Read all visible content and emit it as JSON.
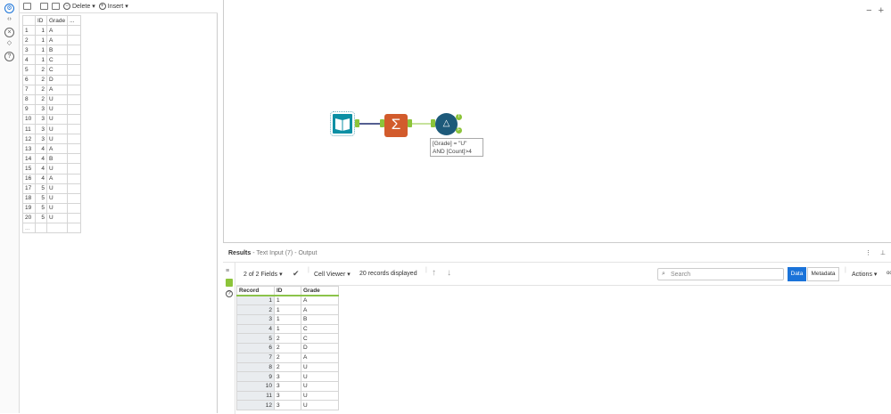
{
  "config": {
    "toolbar": {
      "delete_label": "Delete",
      "insert_label": "Insert"
    },
    "grid": {
      "headers": [
        "",
        "ID",
        "Grade",
        "..."
      ],
      "rows": [
        [
          "1",
          "1",
          "A"
        ],
        [
          "2",
          "1",
          "A"
        ],
        [
          "3",
          "1",
          "B"
        ],
        [
          "4",
          "1",
          "C"
        ],
        [
          "5",
          "2",
          "C"
        ],
        [
          "6",
          "2",
          "D"
        ],
        [
          "7",
          "2",
          "A"
        ],
        [
          "8",
          "2",
          "U"
        ],
        [
          "9",
          "3",
          "U"
        ],
        [
          "10",
          "3",
          "U"
        ],
        [
          "11",
          "3",
          "U"
        ],
        [
          "12",
          "3",
          "U"
        ],
        [
          "13",
          "4",
          "A"
        ],
        [
          "14",
          "4",
          "B"
        ],
        [
          "15",
          "4",
          "U"
        ],
        [
          "16",
          "4",
          "A"
        ],
        [
          "17",
          "5",
          "U"
        ],
        [
          "18",
          "5",
          "U"
        ],
        [
          "19",
          "5",
          "U"
        ],
        [
          "20",
          "5",
          "U"
        ]
      ],
      "new_row": "..."
    }
  },
  "canvas": {
    "zoom_out": "−",
    "zoom_in": "+",
    "filter_annotation_line1": "[Grade] = \"U\"",
    "filter_annotation_line2": "AND [Count]>4",
    "anchor_true": "T",
    "anchor_false": "F"
  },
  "results": {
    "title": "Results",
    "subtitle": " - Text Input (7) - Output",
    "fields_label": "2 of 2 Fields",
    "cell_viewer_label": "Cell Viewer",
    "records_label": "20 records displayed",
    "search_placeholder": "Search",
    "data_label": "Data",
    "metadata_label": "Metadata",
    "actions_label": "Actions",
    "headers": [
      "Record",
      "ID",
      "Grade"
    ],
    "rows": [
      [
        "1",
        "1",
        "A"
      ],
      [
        "2",
        "1",
        "A"
      ],
      [
        "3",
        "1",
        "B"
      ],
      [
        "4",
        "1",
        "C"
      ],
      [
        "5",
        "2",
        "C"
      ],
      [
        "6",
        "2",
        "D"
      ],
      [
        "7",
        "2",
        "A"
      ],
      [
        "8",
        "2",
        "U"
      ],
      [
        "9",
        "3",
        "U"
      ],
      [
        "10",
        "3",
        "U"
      ],
      [
        "11",
        "3",
        "U"
      ],
      [
        "12",
        "3",
        "U"
      ]
    ]
  },
  "colors": {
    "accent": "#1a73d9",
    "input_tool": "#0c8fa4",
    "summarize_tool": "#d25b2c",
    "filter_tool": "#1d5a7a",
    "anchor": "#8cc43a"
  }
}
